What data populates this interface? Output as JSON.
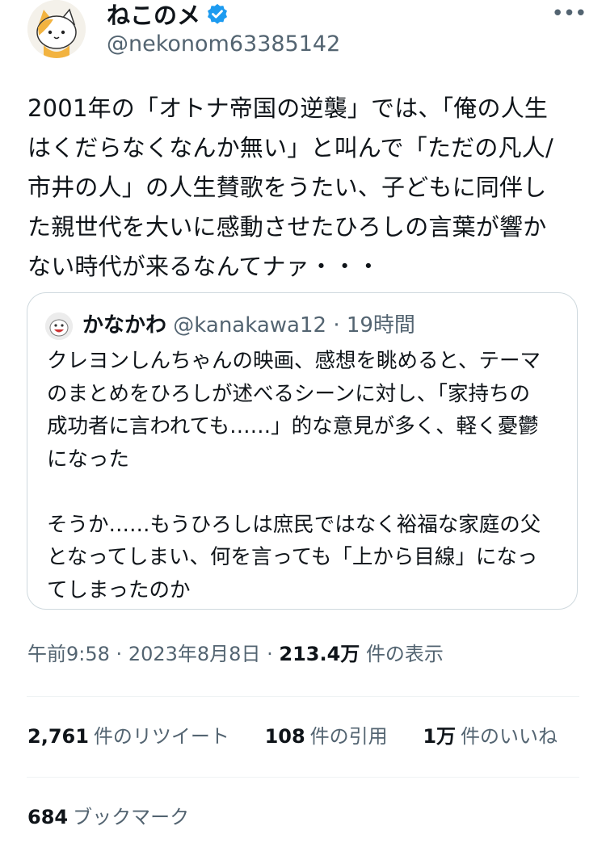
{
  "author": {
    "display_name": "ねこのメ",
    "handle": "@nekonom63385142",
    "avatar_icon": "cat-avatar-icon",
    "verified_icon": "verified-badge-icon",
    "accent_color": "#1d9bf0"
  },
  "more_label": "•••",
  "tweet": {
    "text": "2001年の「オトナ帝国の逆襲」では、「俺の人生\nはくだらなくなんか無い」と叫んで「ただの凡人/\n市井の人」の人生賛歌をうたい、子どもに同伴し\nた親世代を大いに感動させたひろしの言葉が響か\nない時代が来るなんてナァ・・・"
  },
  "quote": {
    "display_name": "かなかわ",
    "handle": "@kanakawa12",
    "separator": "·",
    "time": "19時間",
    "text": "クレヨンしんちゃんの映画、感想を眺めると、テーマ\nのまとめをひろしが述べるシーンに対し、「家持ちの\n成功者に言われても……」的な意見が多く、軽く憂鬱\nになった\n\nそうか……もうひろしは庶民ではなく裕福な家庭の父\nとなってしまい、何を言っても「上から目線」になっ\nてしまったのか"
  },
  "meta": {
    "time": "午前9:58",
    "separator": "·",
    "date": "2023年8月8日",
    "views_count": "213.4万",
    "views_label": "件の表示"
  },
  "stats": {
    "retweets_count": "2,761",
    "retweets_label": "件のリツイート",
    "quotes_count": "108",
    "quotes_label": "件の引用",
    "likes_count": "1万",
    "likes_label": "件のいいね"
  },
  "bookmarks": {
    "count": "684",
    "label": "ブックマーク"
  }
}
